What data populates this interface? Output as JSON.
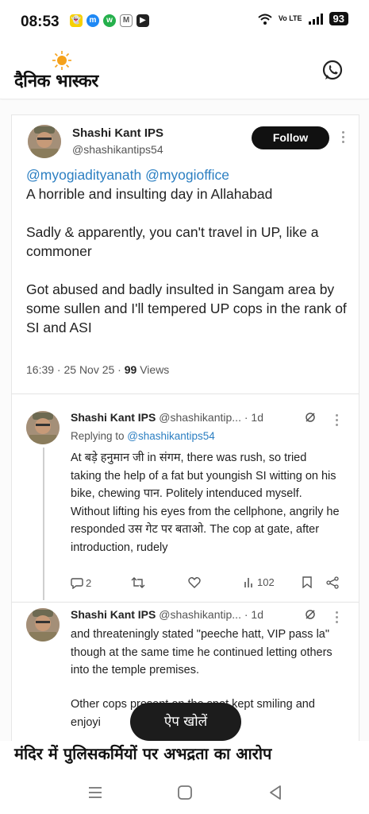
{
  "status_bar": {
    "time": "08:53",
    "notification_icons": [
      "snapchat-icon",
      "messenger-icon",
      "whatsapp-icon",
      "gmail-icon",
      "youtube-icon"
    ],
    "network": "Vo LTE",
    "battery": "93"
  },
  "app": {
    "name": "दैनिक भास्कर",
    "share_icon": "whatsapp-icon"
  },
  "tweet": {
    "author_name": "Shashi Kant IPS",
    "author_handle": "@shashikantips54",
    "follow_label": "Follow",
    "mentions": "@myogiadityanath @myogioffice",
    "line1": "A horrible and insulting day in Allahabad",
    "para2": "Sadly & apparently, you can't travel in UP, like a commoner",
    "para3": "Got abused and badly insulted in Sangam area by some sullen and I'll tempered UP cops in the rank of SI and ASI",
    "meta_prefix": "16:39 · 25 Nov 25 · ",
    "views_count": "99",
    "views_label": " Views"
  },
  "reply1": {
    "author_name": "Shashi Kant IPS",
    "author_handle": "@shashikantip...",
    "time": "· 1d",
    "replying_prefix": "Replying to ",
    "replying_to": "@shashikantips54",
    "text": "At बड़े हनुमान जी in संगम, there was rush, so tried taking the help of a fat but youngish SI witting on his bike, chewing पान. Politely intenduced myself. Without lifting his eyes from the cellphone, angrily he responded उस गेट पर बताओ. The cop at gate, after introduction, rudely",
    "replies": "2",
    "views": "102"
  },
  "reply2": {
    "author_name": "Shashi Kant IPS",
    "author_handle": "@shashikantip...",
    "time": "· 1d",
    "text": "and threateningly stated \"peeche hatt, VIP pass la\" though at the same time he continued letting others into the temple premises.",
    "text2": "Other cops present on the spot kept smiling and enjoyi"
  },
  "open_app_label": "ऐप खोलें",
  "headline": "मंदिर में पुलिसकर्मियों पर अभद्रता का आरोप",
  "colors": {
    "mention": "#2c7fc2",
    "logo_sun": "#f5a11a",
    "follow_bg": "#111111"
  }
}
